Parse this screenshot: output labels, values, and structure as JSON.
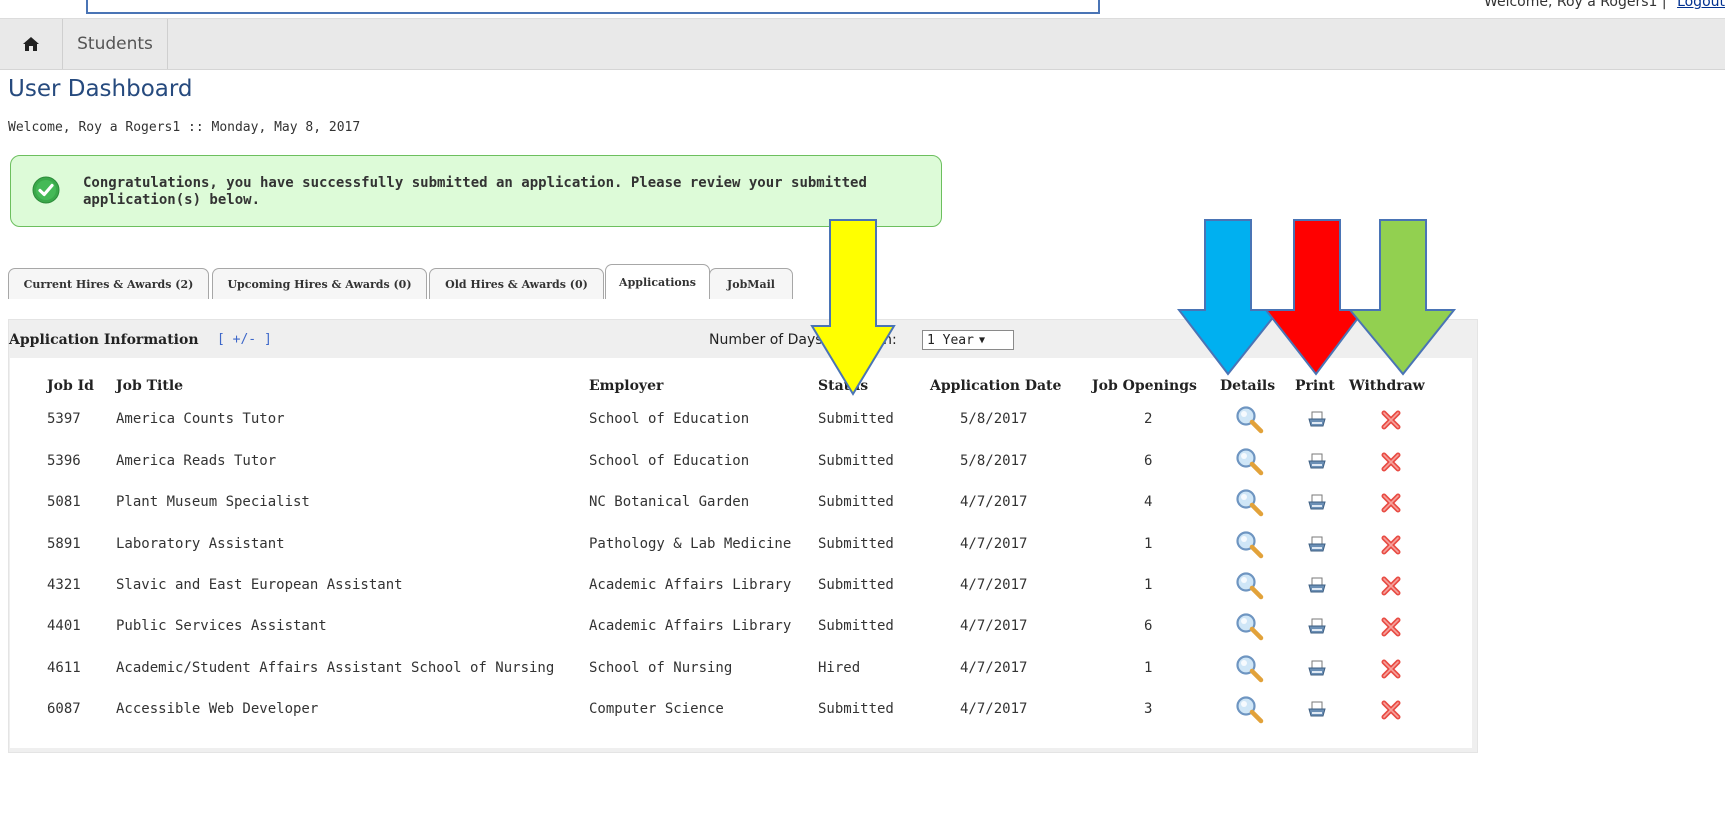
{
  "top": {
    "welcome": "Welcome, Roy a Rogers1",
    "separator": "|",
    "logout": "Logout"
  },
  "nav": {
    "home_icon": "home-icon",
    "tab_students": "Students"
  },
  "page": {
    "title": "User Dashboard",
    "welcome": "Welcome, Roy a Rogers1 :: Monday, May 8, 2017"
  },
  "alert": {
    "icon": "checkmark-icon",
    "text": "Congratulations, you have successfully submitted an application. Please review your submitted application(s) below."
  },
  "tabs": [
    {
      "label": "Current Hires & Awards (2)"
    },
    {
      "label": "Upcoming Hires & Awards (0)"
    },
    {
      "label": "Old Hires & Awards (0)"
    },
    {
      "label": "Applications",
      "active": true
    },
    {
      "label": "JobMail"
    }
  ],
  "panel": {
    "title": "Application Information",
    "toggle": "[ +/- ]",
    "days_label": "Number of Days to Return:",
    "days_value": "1 Year"
  },
  "columns": [
    "Job Id",
    "Job Title",
    "Employer",
    "Status",
    "Application Date",
    "Job Openings",
    "Details",
    "Print",
    "Withdraw"
  ],
  "rows": [
    {
      "id": "5397",
      "title": "America Counts Tutor",
      "employer": "School of Education",
      "status": "Submitted",
      "date": "5/8/2017",
      "openings": "2"
    },
    {
      "id": "5396",
      "title": "America Reads Tutor",
      "employer": "School of Education",
      "status": "Submitted",
      "date": "5/8/2017",
      "openings": "6"
    },
    {
      "id": "5081",
      "title": "Plant Museum Specialist",
      "employer": "NC Botanical Garden",
      "status": "Submitted",
      "date": "4/7/2017",
      "openings": "4"
    },
    {
      "id": "5891",
      "title": "Laboratory Assistant",
      "employer": "Pathology & Lab Medicine",
      "status": "Submitted",
      "date": "4/7/2017",
      "openings": "1"
    },
    {
      "id": "4321",
      "title": "Slavic and East European Assistant",
      "employer": "Academic Affairs Library",
      "status": "Submitted",
      "date": "4/7/2017",
      "openings": "1"
    },
    {
      "id": "4401",
      "title": "Public Services Assistant",
      "employer": "Academic Affairs Library",
      "status": "Submitted",
      "date": "4/7/2017",
      "openings": "6"
    },
    {
      "id": "4611",
      "title": "Academic/Student Affairs Assistant School of Nursing",
      "employer": "School of Nursing",
      "status": "Hired",
      "date": "4/7/2017",
      "openings": "1"
    },
    {
      "id": "6087",
      "title": "Accessible Web Developer",
      "employer": "Computer Science",
      "status": "Submitted",
      "date": "4/7/2017",
      "openings": "3"
    }
  ],
  "row_icons": {
    "details": "magnifier-icon",
    "print": "printer-icon",
    "withdraw": "red-x-icon"
  },
  "annotation_colors": {
    "status_arrow": "#ffff00",
    "details_arrow": "#00b0f0",
    "print_arrow": "#ff0000",
    "withdraw_arrow": "#92d050"
  }
}
